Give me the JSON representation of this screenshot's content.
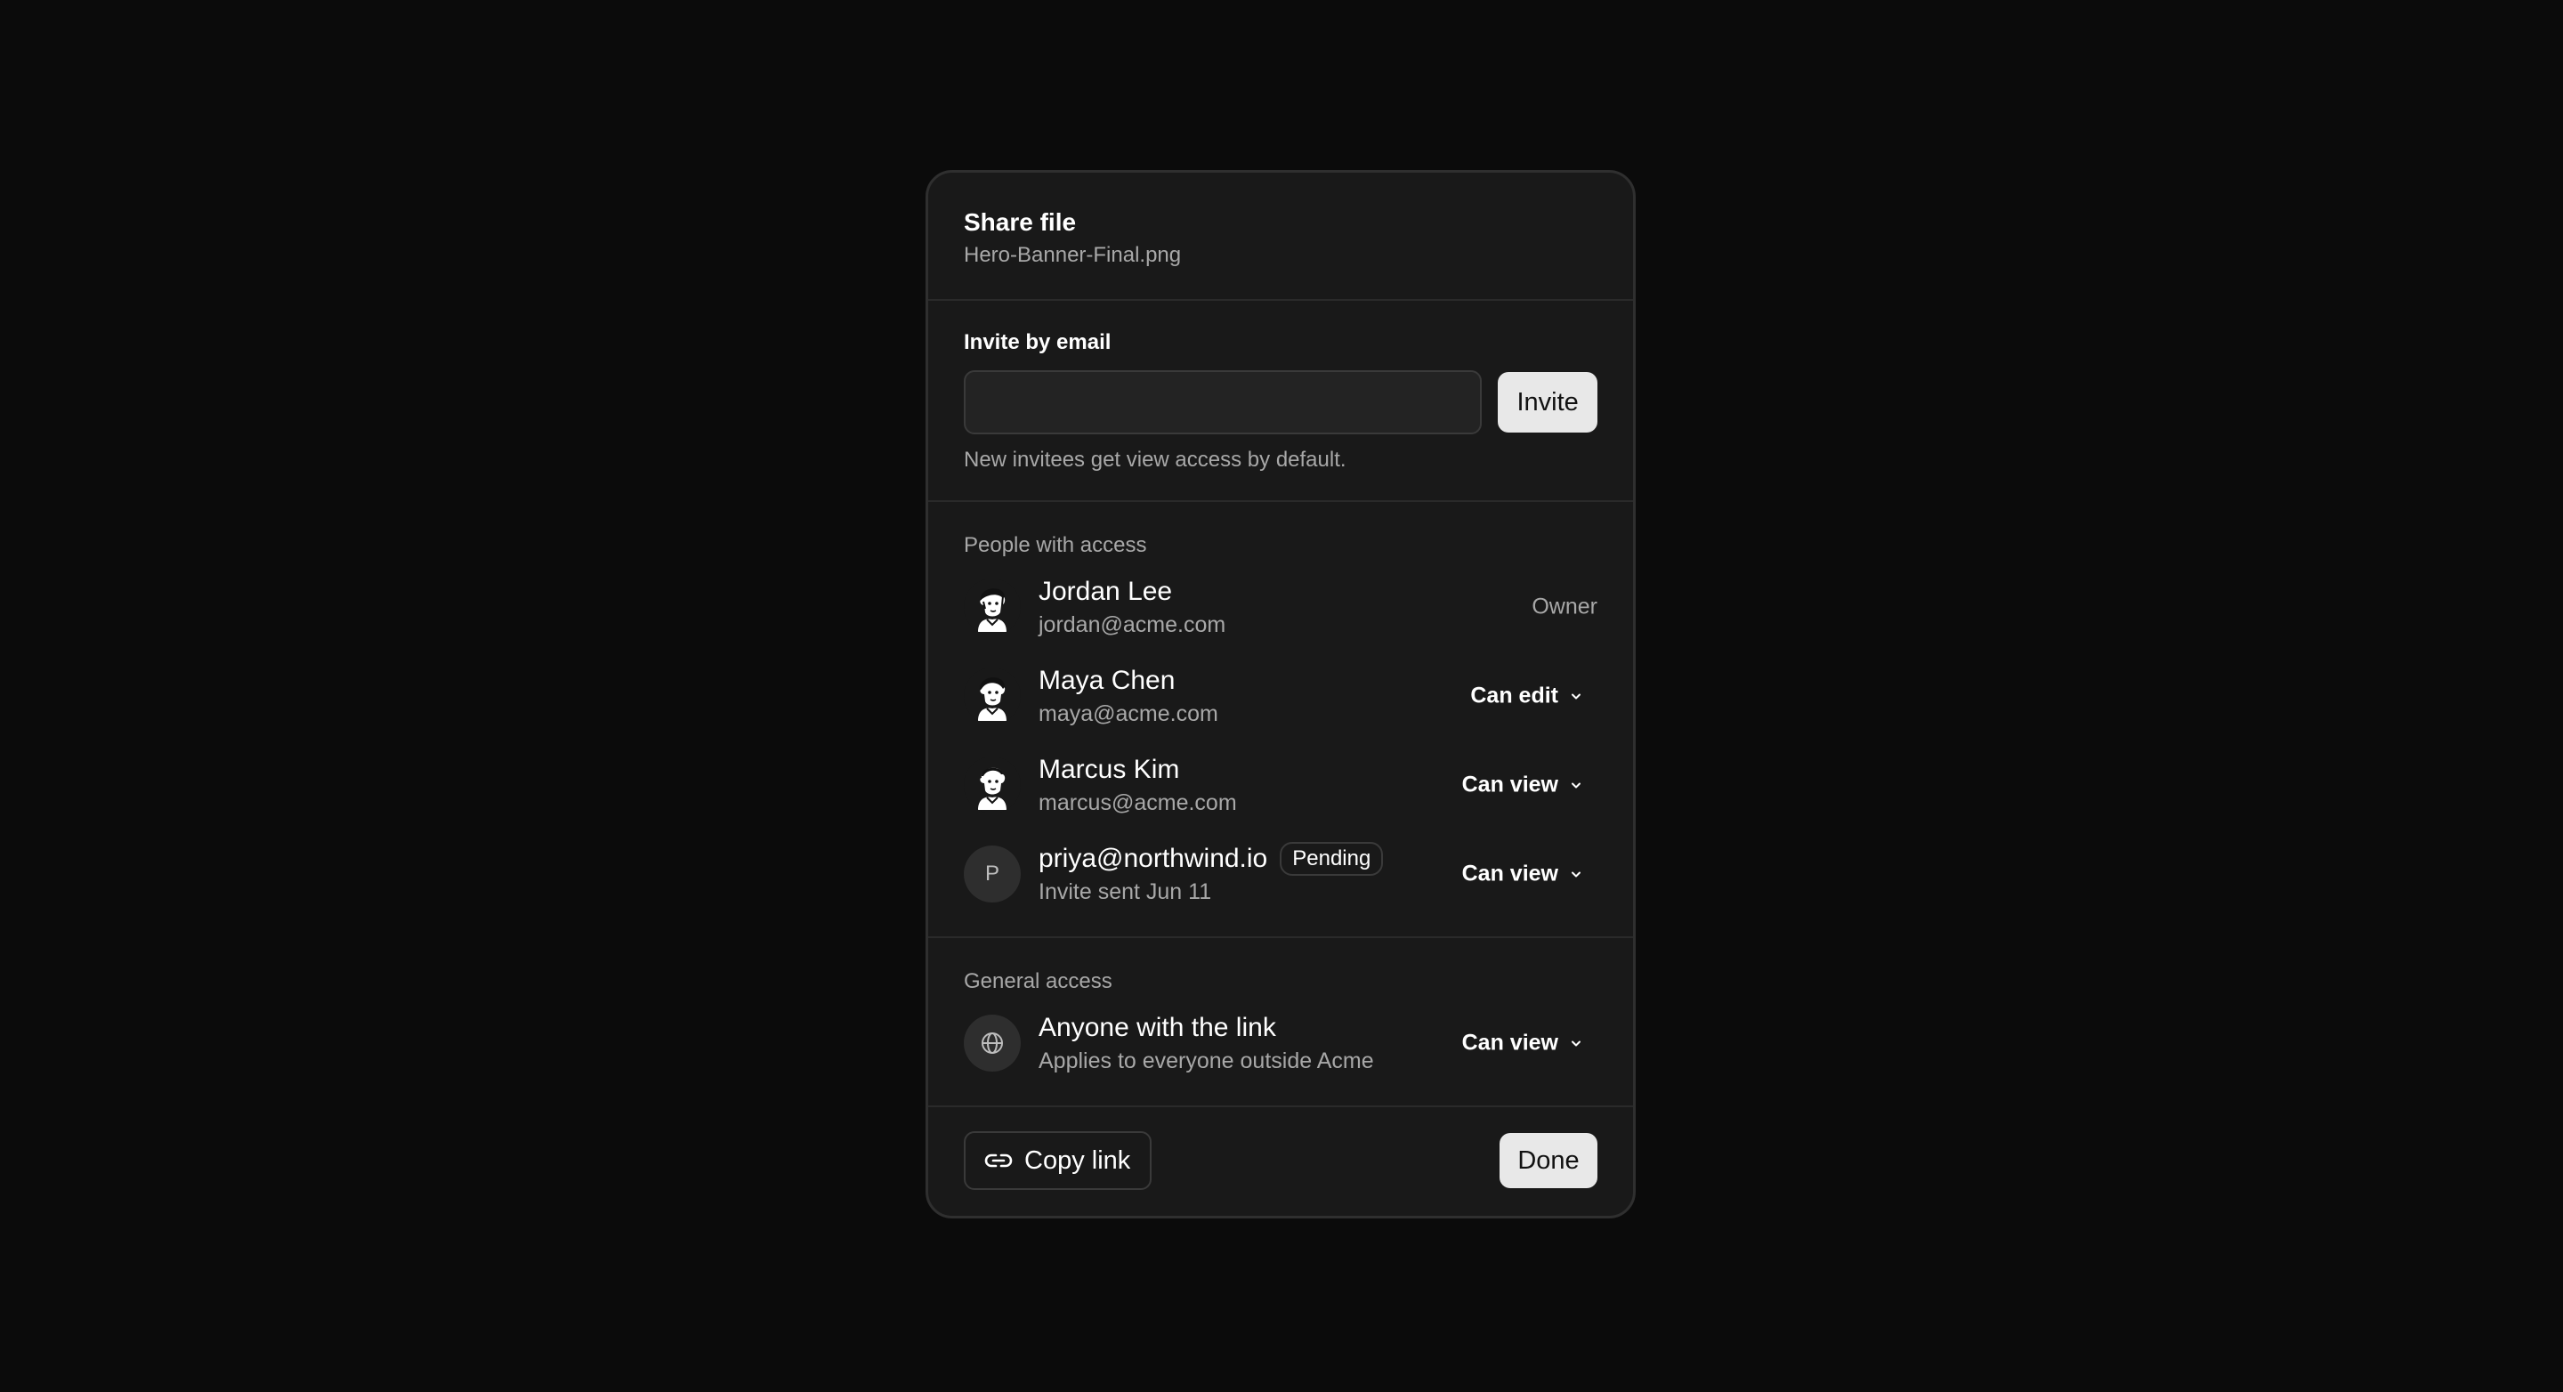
{
  "dialog": {
    "title": "Share file",
    "filename": "Hero-Banner-Final.png"
  },
  "invite": {
    "label": "Invite by email",
    "email_value": "",
    "button_label": "Invite",
    "hint": "New invitees get view access by default."
  },
  "people": {
    "label": "People with access",
    "items": [
      {
        "name": "Jordan Lee",
        "email": "jordan@acme.com",
        "role": "Owner",
        "avatar": "illustrated-avatar"
      },
      {
        "name": "Maya Chen",
        "email": "maya@acme.com",
        "role": "Can edit",
        "avatar": "illustrated-avatar"
      },
      {
        "name": "Marcus Kim",
        "email": "marcus@acme.com",
        "role": "Can view",
        "avatar": "illustrated-avatar"
      },
      {
        "name": "priya@northwind.io",
        "email": "Invite sent Jun 11",
        "role": "Can view",
        "avatar_letter": "P",
        "badge": "Pending"
      }
    ]
  },
  "general": {
    "label": "General access",
    "title": "Anyone with the link",
    "description": "Applies to everyone outside Acme",
    "role": "Can view",
    "icon": "globe-icon"
  },
  "footer": {
    "copy_label": "Copy link",
    "done_label": "Done"
  },
  "colors": {
    "background": "#0b0b0b",
    "panel": "#191919",
    "primary_button": "#e8e8e8"
  }
}
